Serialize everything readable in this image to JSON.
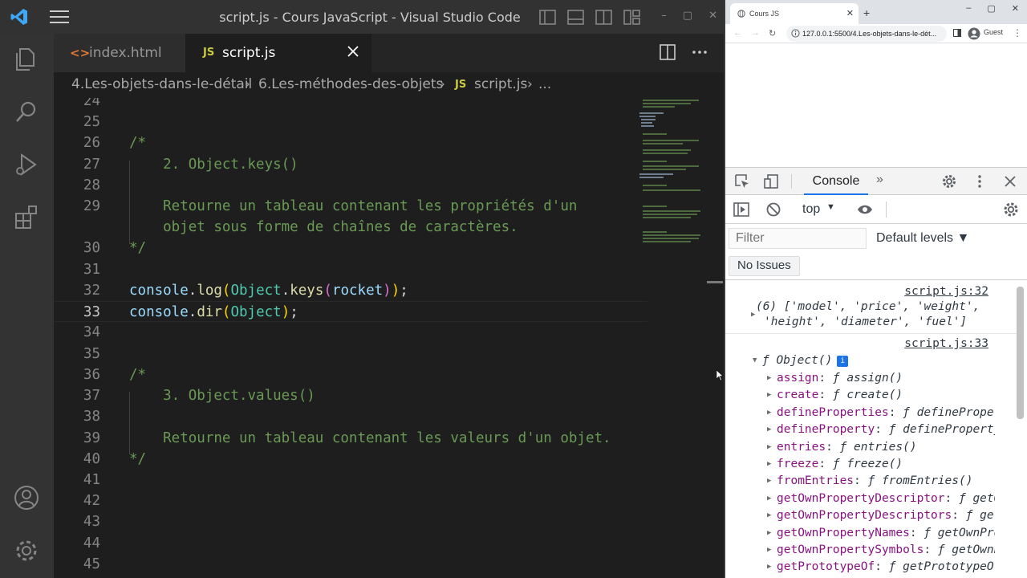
{
  "vscode": {
    "title": "script.js - Cours JavaScript - Visual Studio Code",
    "tabs": [
      {
        "label": "index.html",
        "icon": "<>"
      },
      {
        "label": "script.js",
        "icon": "JS"
      }
    ],
    "breadcrumb": [
      "4.Les-objets-dans-le-détail",
      "6.Les-méthodes-des-objets",
      "script.js",
      "..."
    ],
    "breadcrumb_icon": "JS",
    "window_controls": [
      "–",
      "▢",
      "✕"
    ],
    "lines": [
      {
        "n": "24"
      },
      {
        "n": "25"
      },
      {
        "n": "26"
      },
      {
        "n": "27"
      },
      {
        "n": "28"
      },
      {
        "n": "29"
      },
      {
        "n": ""
      },
      {
        "n": "30"
      },
      {
        "n": "31"
      },
      {
        "n": "32"
      },
      {
        "n": "33"
      },
      {
        "n": "34"
      },
      {
        "n": "35"
      },
      {
        "n": "36"
      },
      {
        "n": "37"
      },
      {
        "n": "38"
      },
      {
        "n": "39"
      },
      {
        "n": "40"
      },
      {
        "n": "41"
      },
      {
        "n": "42"
      },
      {
        "n": "43"
      },
      {
        "n": "44"
      },
      {
        "n": "45"
      }
    ],
    "code": {
      "c26": "/*",
      "c27": "    2. Object.keys()",
      "c29a": "    Retourne un tableau contenant les propriétés d'un",
      "c29b": "    objet sous forme de chaînes de caractères.",
      "c30": "*/",
      "c32": [
        "console",
        ".",
        "log",
        "(",
        "Object",
        ".",
        "keys",
        "(",
        "rocket",
        ")",
        ")",
        ";"
      ],
      "c33": [
        "console",
        ".",
        "dir",
        "(",
        "Object",
        ")",
        ";"
      ],
      "c36": "/*",
      "c37": "    3. Object.values()",
      "c39": "    Retourne un tableau contenant les valeurs d'un objet.",
      "c40": "*/"
    }
  },
  "browser": {
    "tab_title": "Cours JS",
    "tab_close": "✕",
    "new_tab": "+",
    "url": "127.0.0.1:5500/4.Les-objets-dans-le-dét...",
    "profile": "Guest",
    "window_controls": [
      "–",
      "▢",
      "✕"
    ],
    "nav": {
      "back": "←",
      "forward": "→",
      "reload": "↻",
      "menu": "⋮"
    }
  },
  "devtools": {
    "tab": "Console",
    "more_tabs": "»",
    "context": "top",
    "filter_placeholder": "Filter",
    "levels": "Default levels ▼",
    "no_issues": "No Issues",
    "log1_source": "script.js:32",
    "log1_line1": "(6) ['model', 'price', 'weight',",
    "log1_line2": "'height', 'diameter', 'fuel']",
    "log2_source": "script.js:33",
    "log2_head": "ƒ Object()",
    "info": "i",
    "props": [
      {
        "k": "assign",
        "v": "ƒ assign()"
      },
      {
        "k": "create",
        "v": "ƒ create()"
      },
      {
        "k": "defineProperties",
        "v": "ƒ defineProperties()"
      },
      {
        "k": "defineProperty",
        "v": "ƒ defineProperty()"
      },
      {
        "k": "entries",
        "v": "ƒ entries()"
      },
      {
        "k": "freeze",
        "v": "ƒ freeze()"
      },
      {
        "k": "fromEntries",
        "v": "ƒ fromEntries()"
      },
      {
        "k": "getOwnPropertyDescriptor",
        "v": "ƒ getOwnPropertyDescriptor()"
      },
      {
        "k": "getOwnPropertyDescriptors",
        "v": "ƒ getOwnPropertyDescriptors()"
      },
      {
        "k": "getOwnPropertyNames",
        "v": "ƒ getOwnPropertyNames()"
      },
      {
        "k": "getOwnPropertySymbols",
        "v": "ƒ getOwnPropertySymbols()"
      },
      {
        "k": "getPrototypeOf",
        "v": "ƒ getPrototypeOf()"
      }
    ]
  }
}
